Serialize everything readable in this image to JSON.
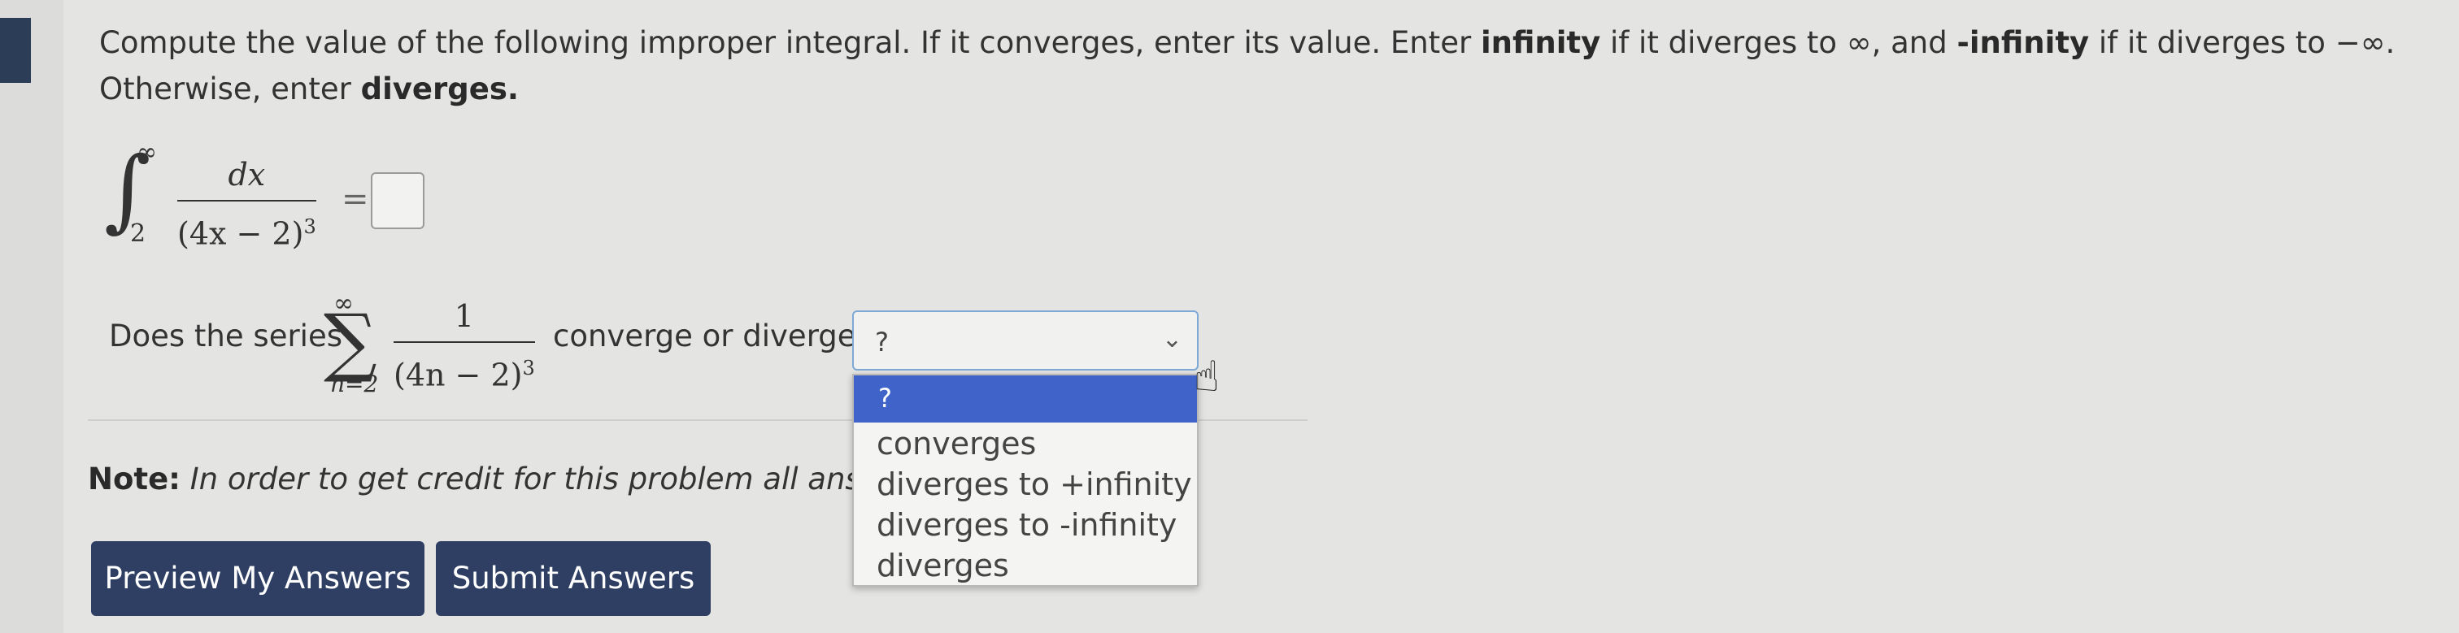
{
  "instructions": {
    "intro": "Compute the value of the following improper integral. If it converges, enter its value. Enter ",
    "bold_infinity": "infinity",
    "mid1": " if it diverges to ∞, and ",
    "bold_neg_infinity": "-infinity",
    "mid2": " if it diverges to −∞. Otherwise, enter ",
    "bold_diverges": "diverges."
  },
  "integral": {
    "upper": "∞",
    "lower": "2",
    "numerator": "dx",
    "denominator": "(4x − 2)",
    "exponent": "3",
    "equals": "=",
    "answer": ""
  },
  "series": {
    "label_before": "Does the series",
    "upper": "∞",
    "lower": "n=2",
    "numerator": "1",
    "denominator": "(4n − 2)",
    "exponent": "3",
    "label_after": "converge or diverge?"
  },
  "select": {
    "current": "?",
    "options": [
      "?",
      "converges",
      "diverges to +infinity",
      "diverges to -infinity",
      "diverges"
    ]
  },
  "note": {
    "bold": "Note:",
    "text": " In order to get credit for this problem all answers must be correct."
  },
  "buttons": {
    "preview": "Preview My Answers",
    "submit": "Submit Answers"
  }
}
